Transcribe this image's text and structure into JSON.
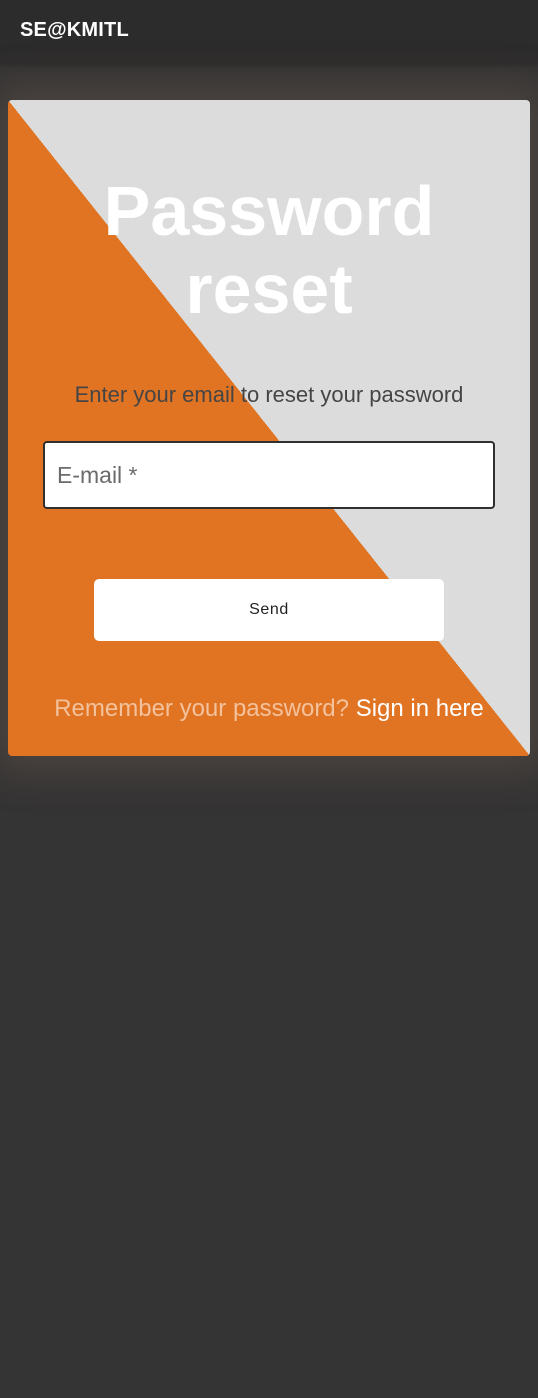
{
  "header": {
    "brand": "SE@KMITL"
  },
  "card": {
    "title_line1": "Password",
    "title_line2": "reset",
    "subtitle": "Enter your email to reset your password",
    "email": {
      "placeholder": "E-mail *",
      "value": ""
    },
    "send_label": "Send",
    "footer_prompt": "Remember your password?",
    "signin_link": "Sign in here"
  },
  "colors": {
    "page_background": "#353434",
    "header_background": "#2d2c2c",
    "accent_orange": "#e07423",
    "card_gray": "#dcdcdc"
  }
}
